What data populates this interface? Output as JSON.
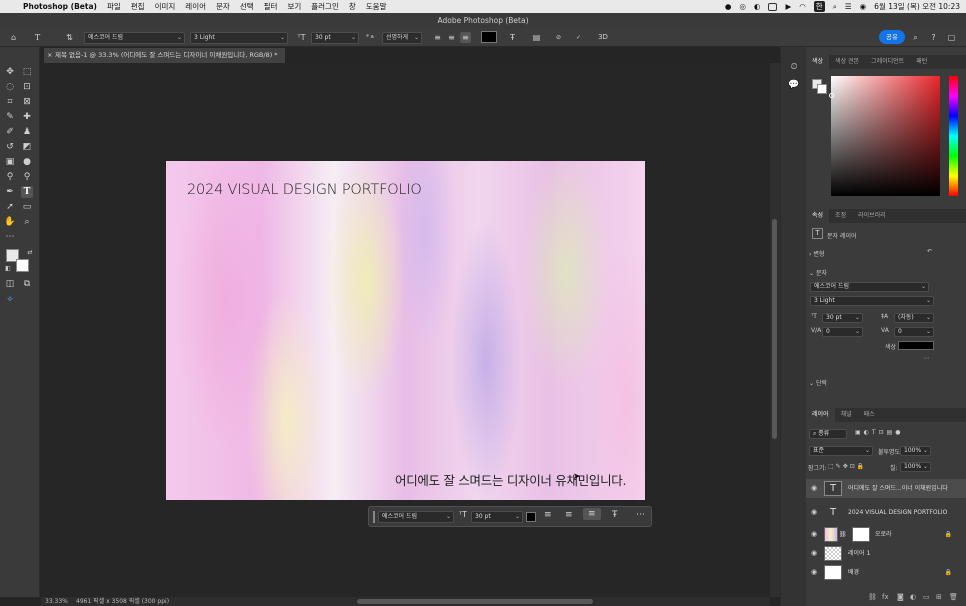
{
  "menubar": {
    "app": "Photoshop (Beta)",
    "items": [
      "파일",
      "편집",
      "이미지",
      "레이어",
      "문자",
      "선택",
      "필터",
      "보기",
      "플러그인",
      "창",
      "도움말"
    ],
    "clock": "6월 13일 (목) 오전 10:23"
  },
  "titlebar": {
    "title": "Adobe Photoshop (Beta)"
  },
  "options": {
    "font_family": "에스코어 드림",
    "font_style": "3 Light",
    "font_size": "30 pt",
    "aa_label": "ª a",
    "antialias": "선명하게",
    "mode_3d": "3D",
    "share": "공유",
    "text_color": "#000000"
  },
  "document_tab": {
    "label": "제목 없음-1 @ 33.3% (어디에도 잘 스며드는 디자이너 이채원입니다, RGB/8) *"
  },
  "canvas": {
    "title": "2024 VISUAL DESIGN PORTFOLIO",
    "subtitle": "어디에도 잘 스며드는 디자이너 유채민입니다."
  },
  "ctxbar": {
    "font": "에스코어 드림",
    "size": "30 pt"
  },
  "status": {
    "zoom": "33.33%",
    "info": "4961 픽셀 x 3508 픽셀 (300 ppi)"
  },
  "color_panel": {
    "tabs": [
      "색상",
      "색상 견본",
      "그레이디언트",
      "패턴"
    ]
  },
  "props_panel": {
    "tabs": [
      "속성",
      "조정",
      "라이브러리"
    ],
    "layer_kind": "문자 레이어",
    "transform": "변형",
    "character": "문자",
    "font": "에스코어 드림",
    "style": "3 Light",
    "size": "30 pt",
    "leading": "(자동)",
    "kerning": "0",
    "tracking": "0",
    "color_label": "색상",
    "paragraph": "단락"
  },
  "layers_panel": {
    "tabs": [
      "레이어",
      "채널",
      "패스"
    ],
    "filter": "종류",
    "blend": "표준",
    "opacity_label": "불투명도:",
    "opacity": "100%",
    "lock_label": "잠그기:",
    "fill_label": "칠:",
    "fill": "100%",
    "layers": [
      {
        "name": "어디에도 잘 스며드...이너 이채원입니다",
        "kind": "text",
        "selected": true
      },
      {
        "name": "2024 VISUAL DESIGN PORTFOLIO",
        "kind": "text",
        "selected": false
      },
      {
        "name": "오로라",
        "kind": "image-mask",
        "selected": false
      },
      {
        "name": "레이어 1",
        "kind": "pixel",
        "selected": false
      },
      {
        "name": "배경",
        "kind": "background",
        "selected": false
      }
    ]
  }
}
